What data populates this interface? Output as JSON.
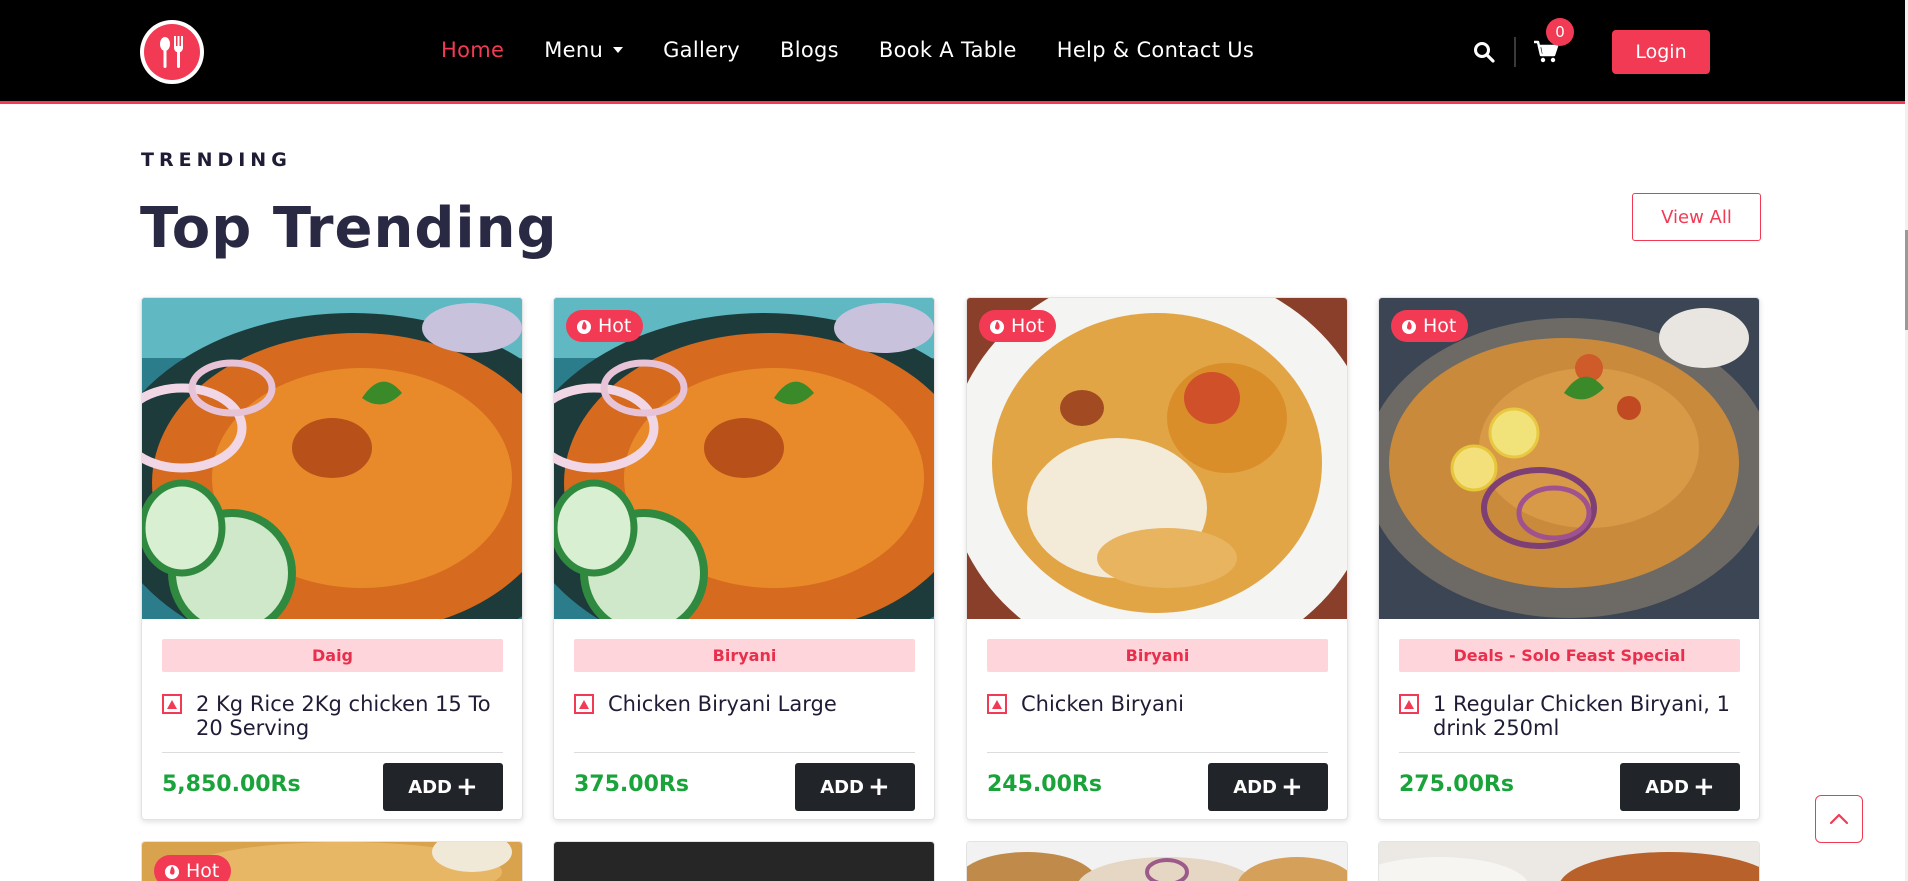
{
  "nav": {
    "items": [
      {
        "label": "Home",
        "active": true
      },
      {
        "label": "Menu",
        "dropdown": true
      },
      {
        "label": "Gallery"
      },
      {
        "label": "Blogs"
      },
      {
        "label": "Book A Table"
      },
      {
        "label": "Help & Contact Us"
      }
    ],
    "cart_count": "0",
    "login_label": "Login",
    "accent_color": "#f23a55"
  },
  "section": {
    "eyebrow": "TRENDING",
    "title": "Top Trending",
    "view_all_label": "View All"
  },
  "cards": [
    {
      "hot": false,
      "category": "Daig",
      "title": "2 Kg Rice 2Kg chicken 15 To 20 Serving",
      "price": "5,850.00Rs",
      "add_label": "ADD"
    },
    {
      "hot": true,
      "hot_label": "Hot",
      "category": "Biryani",
      "title": "Chicken Biryani Large",
      "price": "375.00Rs",
      "add_label": "ADD"
    },
    {
      "hot": true,
      "hot_label": "Hot",
      "category": "Biryani",
      "title": "Chicken Biryani",
      "price": "245.00Rs",
      "add_label": "ADD"
    },
    {
      "hot": true,
      "hot_label": "Hot",
      "category": "Deals - Solo Feast Special",
      "title": "1 Regular Chicken Biryani, 1 drink 250ml",
      "price": "275.00Rs",
      "add_label": "ADD"
    }
  ],
  "next_row": {
    "first_hot_label": "Hot"
  },
  "icons": {
    "logo": "fork-spoon-logo-icon",
    "search": "search-icon",
    "cart": "cart-icon",
    "hot": "flame-icon",
    "veg_mark": "non-veg-triangle-icon",
    "add": "plus-icon",
    "to_top": "chevron-up-icon"
  },
  "colors": {
    "price": "#1aa33a",
    "category_bg": "#ffd5dc",
    "add_button": "#212529"
  }
}
